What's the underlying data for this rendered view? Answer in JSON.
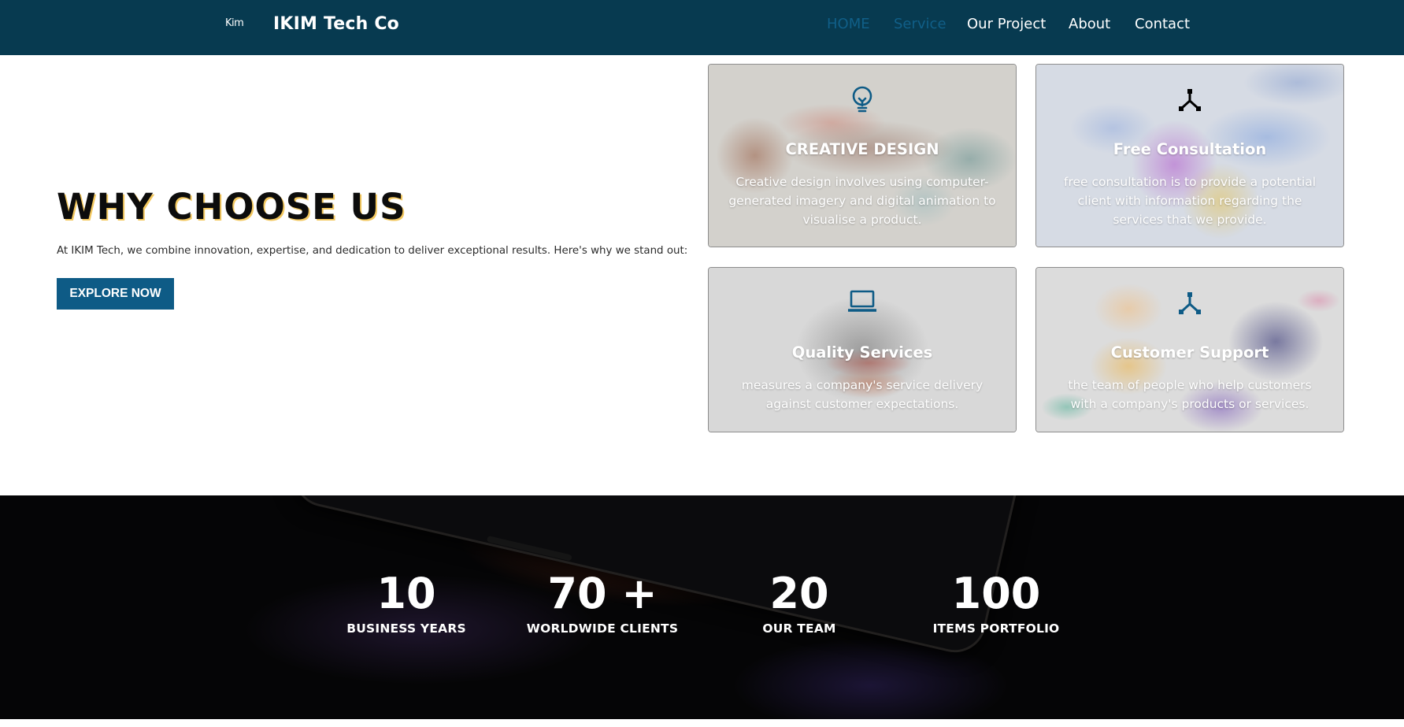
{
  "brand": {
    "logo_text": "Kim",
    "name": "IKIM Tech Co"
  },
  "nav": {
    "items": [
      {
        "label": "HOME",
        "active": true
      },
      {
        "label": "Service",
        "active": true
      },
      {
        "label": "Our Project",
        "active": false
      },
      {
        "label": "About",
        "active": false
      },
      {
        "label": "Contact",
        "active": false
      }
    ]
  },
  "hero": {
    "title": "WHY CHOOSE US",
    "text": "At IKIM Tech, we combine innovation, expertise, and dedication to deliver exceptional results. Here's why we stand out:",
    "button_label": "EXPLORE NOW"
  },
  "cards": [
    {
      "icon": "lightbulb-icon",
      "title": "CREATIVE DESIGN",
      "text": "Creative design involves using computer-generated imagery and digital animation to visualise a product."
    },
    {
      "icon": "hub-icon",
      "title": "Free Consultation",
      "text": "free consultation is to provide a potential client with information regarding the services that we provide."
    },
    {
      "icon": "laptop-icon",
      "title": "Quality Services",
      "text": "measures a company's service delivery against customer expectations."
    },
    {
      "icon": "hub-icon",
      "title": "Customer Support",
      "text": "the team of people who help customers with a company's products or services."
    }
  ],
  "stats": [
    {
      "value": "10",
      "label": "BUSINESS YEARS"
    },
    {
      "value": "70 +",
      "label": "WORLDWIDE CLIENTS"
    },
    {
      "value": "20",
      "label": "OUR TEAM"
    },
    {
      "value": "100",
      "label": "ITEMS PORTFOLIO"
    }
  ],
  "colors": {
    "navbar": "#073a50",
    "nav_active": "#105f88",
    "button": "#0e5b86",
    "icon_blue": "#0e5b86"
  }
}
